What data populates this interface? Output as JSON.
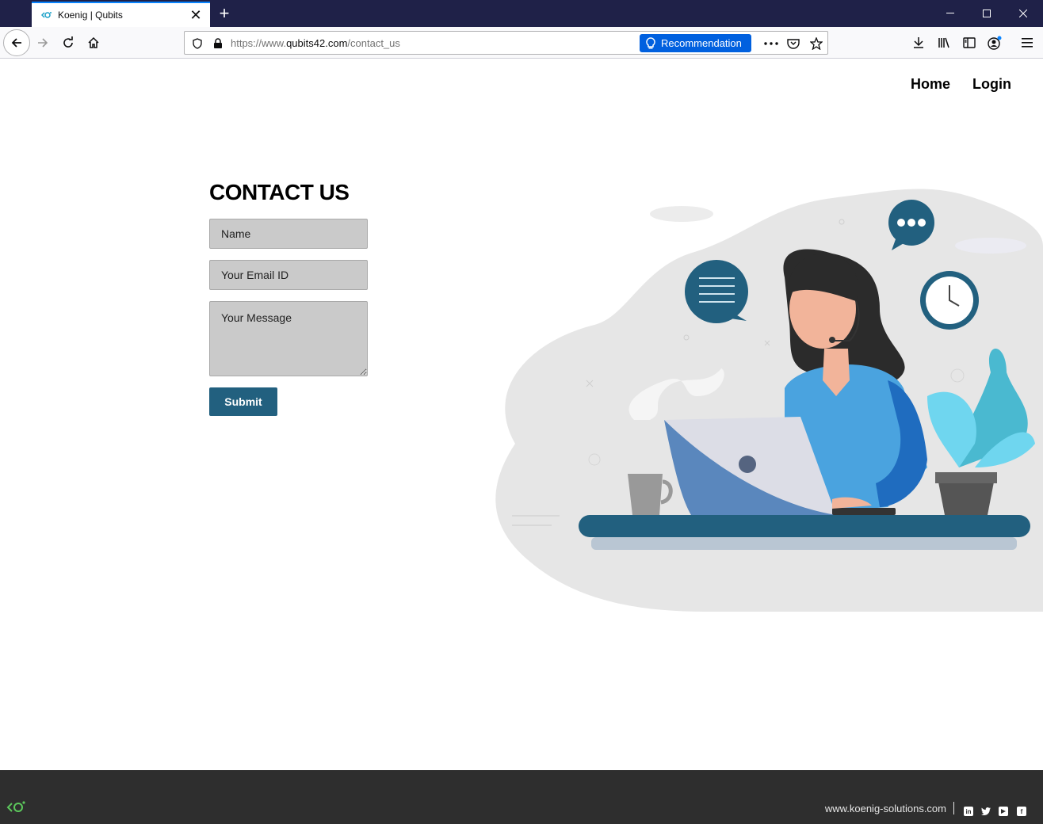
{
  "browser": {
    "tab_title": "Koenig | Qubits",
    "url_prefix": "https://www.",
    "url_host": "qubits42.com",
    "url_path": "/contact_us",
    "recommendation_label": "Recommendation",
    "accent_color": "#0a84ff"
  },
  "nav": {
    "home": "Home",
    "login": "Login"
  },
  "contact": {
    "title": "CONTACT US",
    "name_placeholder": "Name",
    "email_placeholder": "Your Email ID",
    "message_placeholder": "Your Message",
    "submit_label": "Submit",
    "button_color": "#22607f"
  },
  "footer": {
    "website": "www.koenig-solutions.com",
    "social": [
      "linkedin-icon",
      "twitter-icon",
      "youtube-icon",
      "facebook-icon"
    ]
  }
}
